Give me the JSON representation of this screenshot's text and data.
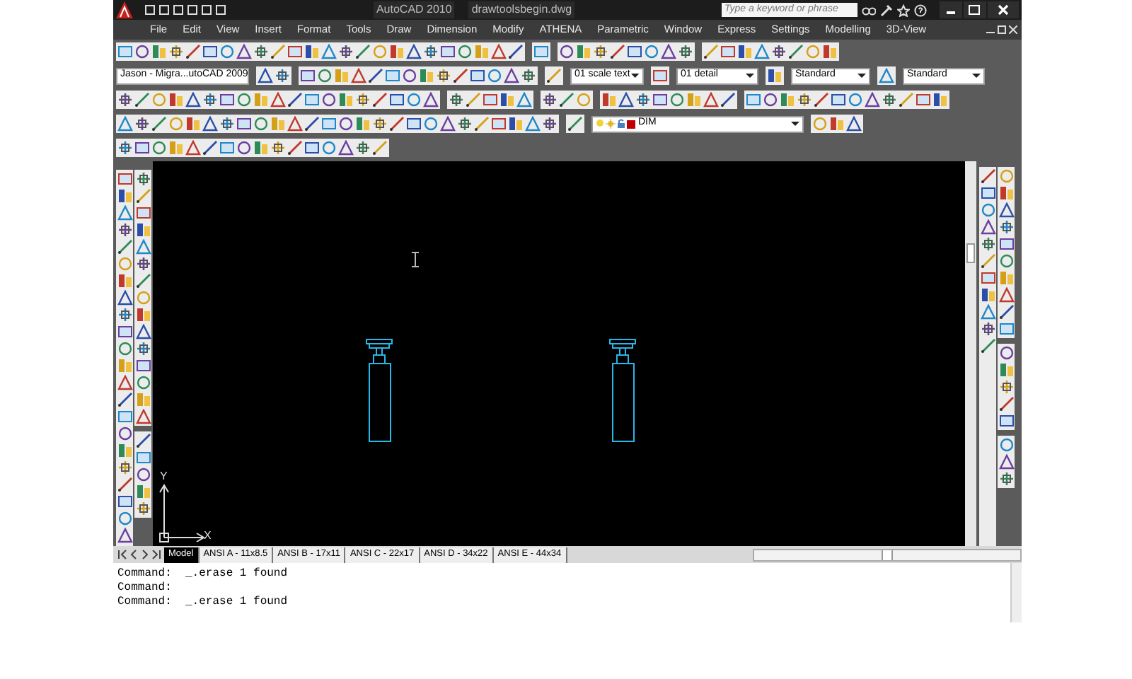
{
  "title_bar": {
    "app": "AutoCAD 2010",
    "document": "drawtoolsbegin.dwg",
    "search": {
      "placeholder": "Type a keyword or phrase"
    }
  },
  "menu_bar": {
    "items": [
      "File",
      "Edit",
      "View",
      "Insert",
      "Format",
      "Tools",
      "Draw",
      "Dimension",
      "Modify",
      "ATHENA",
      "Parametric",
      "Window",
      "Express",
      "Settings",
      "Modelling",
      "3D-View"
    ]
  },
  "toolbars": {
    "workspace": "Jason - Migra...utoCAD 2009",
    "text_style": "01 scale text",
    "dim_style": "01 detail",
    "table_style": "Standard",
    "multileader_style": "Standard",
    "layer": "DIM"
  },
  "drawing": {
    "ucs": {
      "y_label": "Y",
      "x_label": "X"
    }
  },
  "layout_tabs": [
    {
      "label": "Model",
      "selected": true
    },
    {
      "label": "ANSI A - 11x8.5",
      "selected": false
    },
    {
      "label": "ANSI B - 17x11",
      "selected": false
    },
    {
      "label": "ANSI C - 22x17",
      "selected": false
    },
    {
      "label": "ANSI D - 34x22",
      "selected": false
    },
    {
      "label": "ANSI E - 44x34",
      "selected": false
    }
  ],
  "command_lines": [
    "Command:  _.erase 1 found",
    "Command:",
    "Command:  _.erase 1 found"
  ]
}
